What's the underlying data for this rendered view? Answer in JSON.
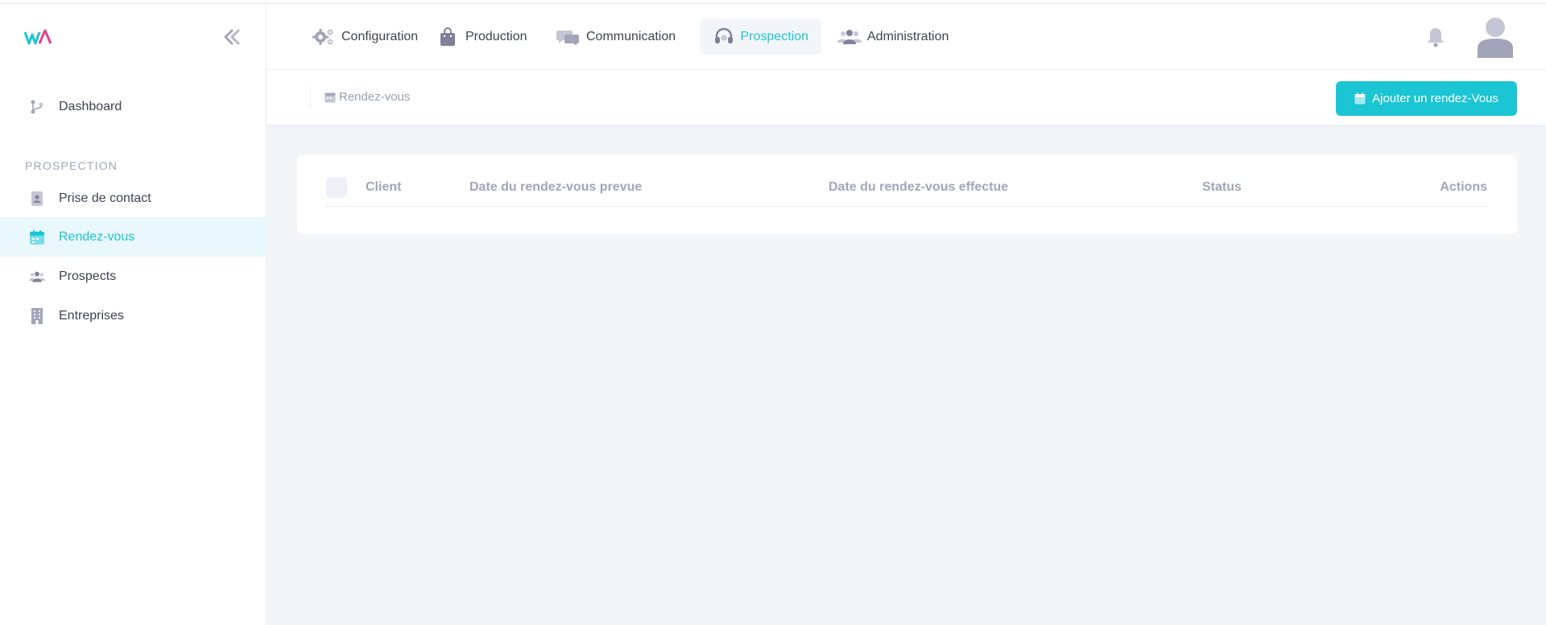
{
  "sidebar": {
    "logo_text": "WA",
    "dashboard": "Dashboard",
    "section_title": "Prospection",
    "items": [
      {
        "label": "Prise de contact",
        "icon": "contact-file-icon"
      },
      {
        "label": "Rendez-vous",
        "icon": "calendar-icon",
        "active": true
      },
      {
        "label": "Prospects",
        "icon": "users-icon"
      },
      {
        "label": "Entreprises",
        "icon": "building-icon"
      }
    ]
  },
  "header": {
    "nav": [
      {
        "label": "Configuration",
        "icon": "gears-icon"
      },
      {
        "label": "Production",
        "icon": "bag-icon"
      },
      {
        "label": "Communication",
        "icon": "chat-icon"
      },
      {
        "label": "Prospection",
        "icon": "headset-icon",
        "active": true
      },
      {
        "label": "Administration",
        "icon": "users-icon"
      }
    ]
  },
  "subheader": {
    "breadcrumb": "Rendez-vous",
    "add_button": "Ajouter un rendez-Vous"
  },
  "table": {
    "columns": [
      "Client",
      "Date du rendez-vous prevue",
      "Date du rendez-vous effectue",
      "Status",
      "Actions"
    ],
    "rows": []
  },
  "colors": {
    "accent": "#1bc5d3",
    "muted": "#a2a5b9",
    "background": "#f3f6f9"
  }
}
